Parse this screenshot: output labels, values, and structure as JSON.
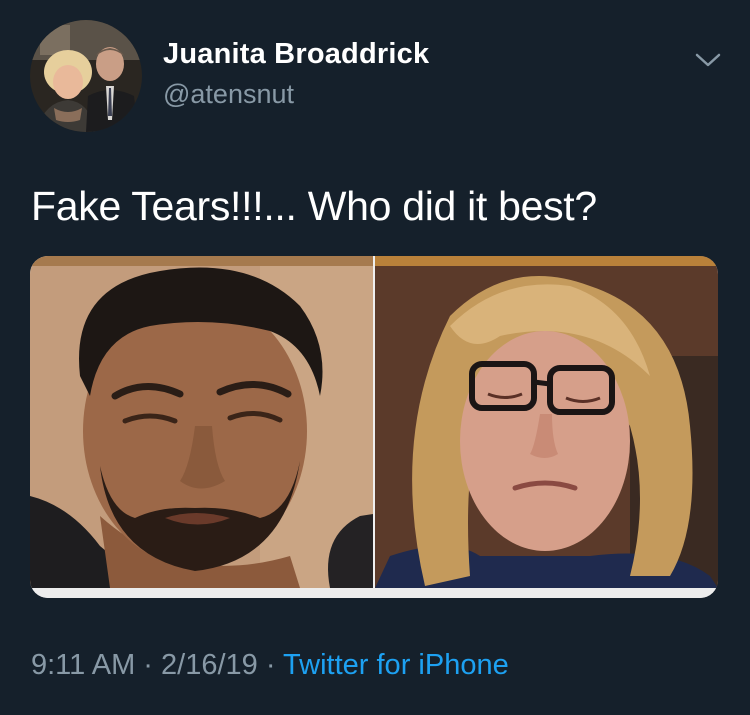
{
  "tweet": {
    "author_name": "Juanita Broaddrick",
    "author_handle": "@atensnut",
    "text": "Fake Tears!!!... Who did it best?",
    "time": "9:11 AM",
    "separator": " · ",
    "date": "2/16/19",
    "source": "Twitter for iPhone"
  },
  "icons": {
    "menu": "chevron-down-icon"
  },
  "colors": {
    "background": "#15202b",
    "secondary_text": "#8899a6",
    "link": "#1da1f2",
    "primary_text": "#ffffff"
  }
}
